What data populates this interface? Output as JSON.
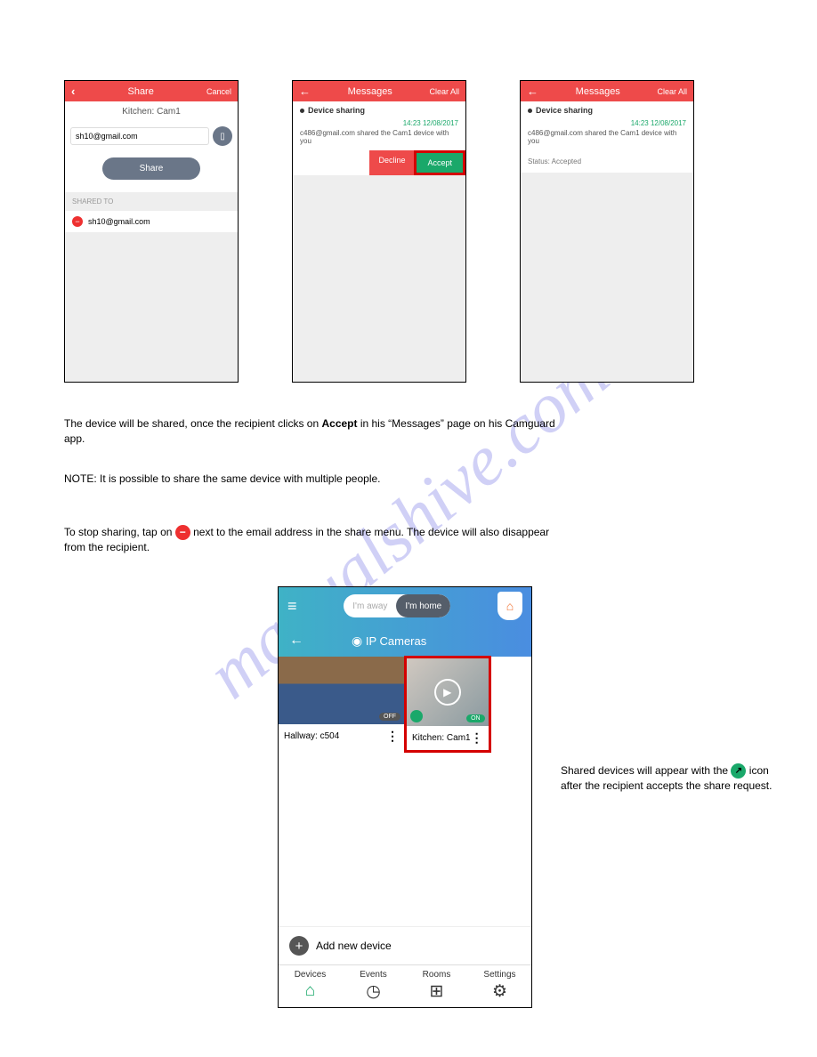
{
  "watermark": "manualshive.com",
  "screen1": {
    "back": "‹",
    "title": "Share",
    "cancel": "Cancel",
    "subtitle": "Kitchen: Cam1",
    "email": "sh10@gmail.com",
    "share_btn": "Share",
    "shared_to": "SHARED TO",
    "shared_email": "sh10@gmail.com"
  },
  "screen2": {
    "back": "←",
    "title": "Messages",
    "clear": "Clear All",
    "section": "Device sharing",
    "timestamp": "14:23 12/08/2017",
    "message": "c486@gmail.com shared the Cam1 device with you",
    "decline": "Decline",
    "accept": "Accept"
  },
  "screen3": {
    "back": "←",
    "title": "Messages",
    "clear": "Clear All",
    "section": "Device sharing",
    "timestamp": "14:23 12/08/2017",
    "message": "c486@gmail.com shared the Cam1 device with you",
    "status": "Status: Accepted"
  },
  "body": {
    "p1a": "The device will be shared, once the recipient clicks on ",
    "p1b": " in his “Messages” page on his Camguard",
    "p1c": "app.",
    "p2": "NOTE: It is possible to share the same device with multiple people.",
    "p3a": "To stop sharing, tap on ",
    "p3b": " next to the email address in the share menu. The device will also disappear",
    "p3c": "from the recipient.",
    "p4a": "Shared devices will appear with the ",
    "p4b": " icon after the recipient accepts the share request."
  },
  "bigscreen": {
    "away": "I'm away",
    "home": "I'm home",
    "back": "←",
    "title": "IP Cameras",
    "cam1": "Hallway: c504",
    "off": "OFF",
    "cam2": "Kitchen: Cam1",
    "on": "ON",
    "add": "Add new device",
    "tabs": [
      "Devices",
      "Events",
      "Rooms",
      "Settings"
    ]
  }
}
